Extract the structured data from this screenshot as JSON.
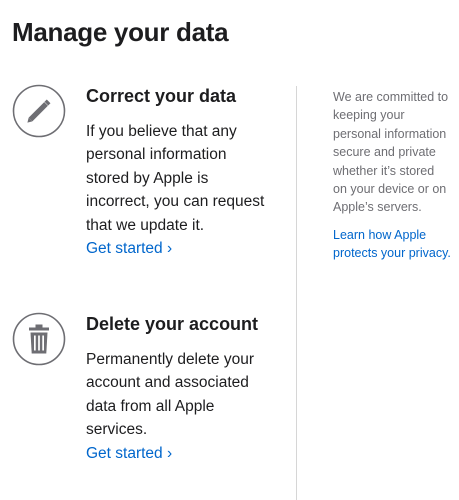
{
  "page": {
    "title": "Manage your data"
  },
  "sections": {
    "correct": {
      "icon": "pencil-icon",
      "heading": "Correct your data",
      "text": "If you believe that any personal information stored by Apple is incorrect, you can request that we update it.",
      "link": "Get started ›"
    },
    "delete": {
      "icon": "trash-icon",
      "heading": "Delete your account",
      "text": "Permanently delete your account and associated data from all Apple services.",
      "link": "Get started ›"
    }
  },
  "sidebar": {
    "text": "We are committed to keeping your personal information secure and private whether it’s stored on your device or on Apple’s servers.",
    "link": "Learn how Apple protects your privacy."
  },
  "colors": {
    "link": "#0066cc",
    "text": "#1d1d1f",
    "muted": "#6e6e73",
    "icon": "#6e6e73"
  }
}
